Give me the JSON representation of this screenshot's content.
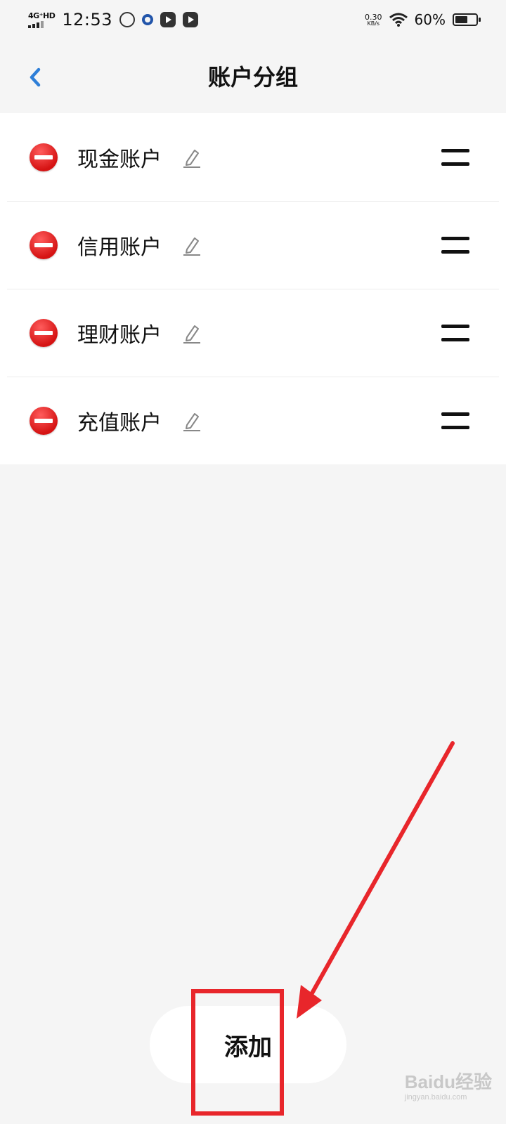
{
  "status_bar": {
    "network": "4G⁺HD",
    "time": "12:53",
    "speed_value": "0.30",
    "speed_unit": "KB/s",
    "battery_percent": "60%",
    "battery_level": 0.6
  },
  "header": {
    "title": "账户分组",
    "back_icon": "chevron-left-icon",
    "accent_color": "#2f7fd8"
  },
  "accounts": [
    {
      "label": "现金账户"
    },
    {
      "label": "信用账户"
    },
    {
      "label": "理财账户"
    },
    {
      "label": "充值账户"
    }
  ],
  "add_button": {
    "label": "添加"
  },
  "annotation": {
    "color": "#e8262b"
  },
  "watermark": {
    "text": "Baidu经验",
    "subtext": "jingyan.baidu.com"
  }
}
